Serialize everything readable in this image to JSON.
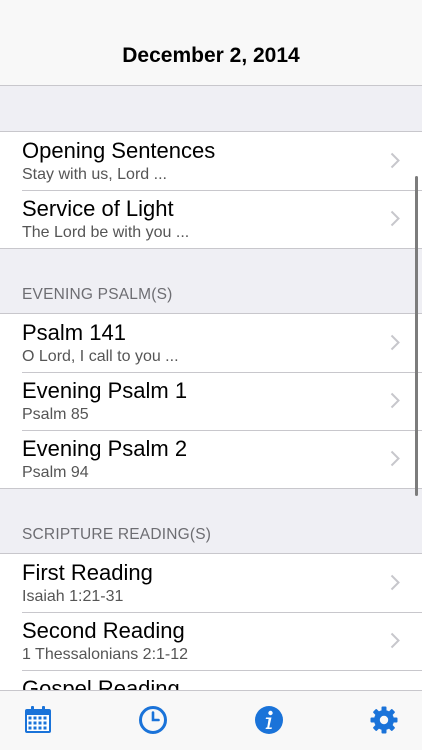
{
  "navbar": {
    "title": "December 2, 2014"
  },
  "sections": {
    "opening": {
      "items": [
        {
          "title": "Opening Sentences",
          "subtitle": "Stay with us, Lord ..."
        },
        {
          "title": "Service of Light",
          "subtitle": "The Lord be with you ..."
        }
      ]
    },
    "psalms": {
      "header": "EVENING PSALM(S)",
      "items": [
        {
          "title": "Psalm 141",
          "subtitle": "O Lord, I call to you ..."
        },
        {
          "title": "Evening Psalm 1",
          "subtitle": "Psalm 85"
        },
        {
          "title": "Evening Psalm 2",
          "subtitle": "Psalm 94"
        }
      ]
    },
    "scripture": {
      "header": "SCRIPTURE READING(S)",
      "items": [
        {
          "title": "First Reading",
          "subtitle": "Isaiah 1:21-31"
        },
        {
          "title": "Second Reading",
          "subtitle": "1 Thessalonians 2:1-12"
        },
        {
          "title": "Gospel Reading",
          "subtitle": ""
        }
      ]
    }
  },
  "tabbar": {
    "tabs": [
      {
        "icon": "calendar-icon"
      },
      {
        "icon": "clock-icon"
      },
      {
        "icon": "info-icon"
      },
      {
        "icon": "gear-icon"
      }
    ]
  },
  "colors": {
    "accent": "#1a73d9",
    "background": "#efeff4",
    "separator": "#c8c7cc",
    "subtitle": "#555555",
    "header_text": "#6d6d72"
  }
}
